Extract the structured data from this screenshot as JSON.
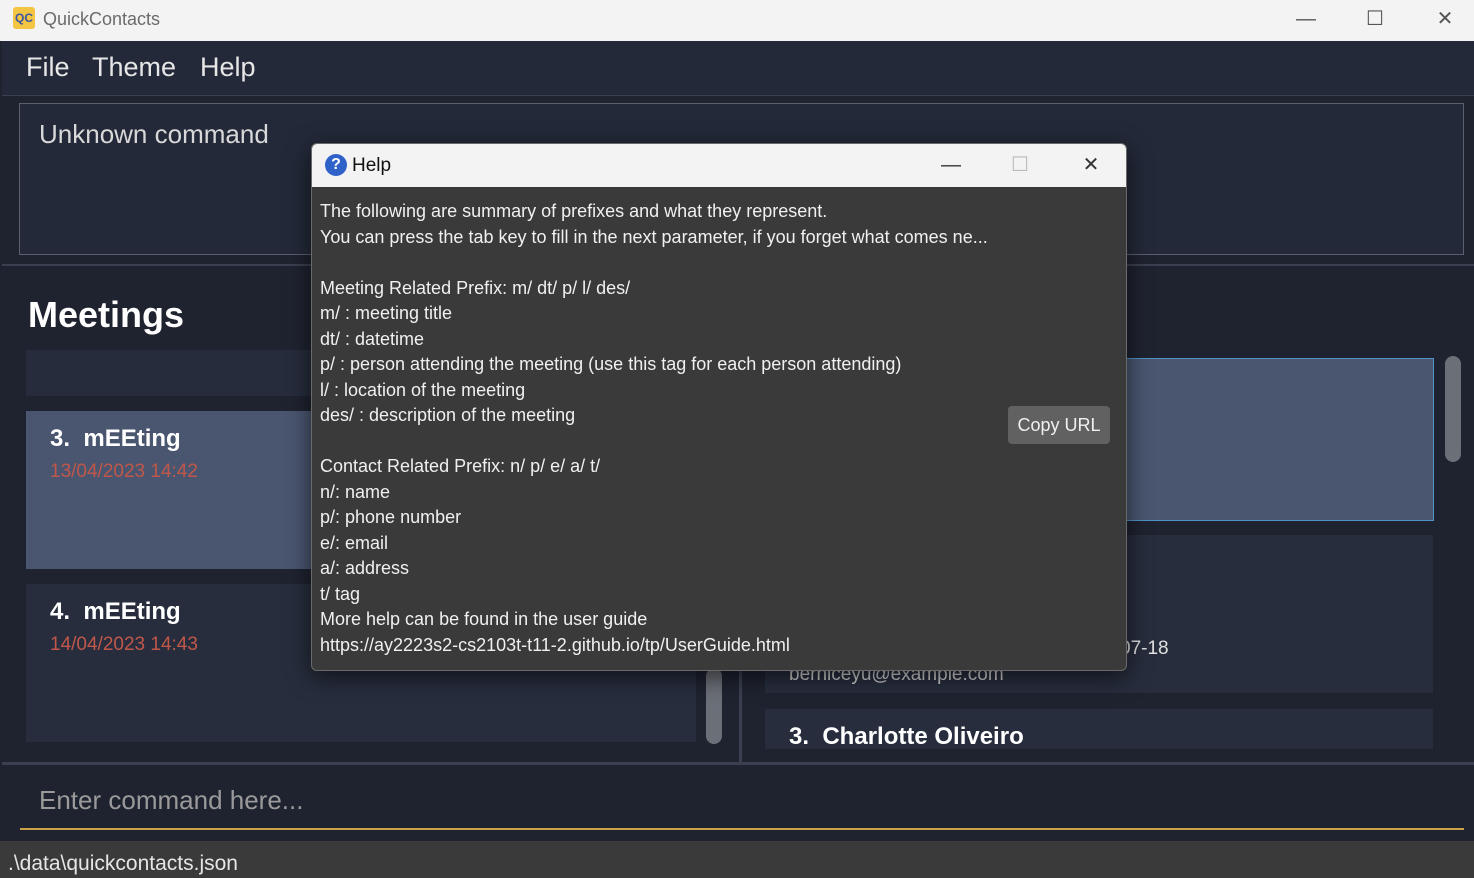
{
  "app": {
    "title": "QuickContacts",
    "icon_label": "QC",
    "window_controls": {
      "minimize": "—",
      "maximize": "☐",
      "close": "✕"
    }
  },
  "menu": [
    "File",
    "Theme",
    "Help"
  ],
  "result_display": "Unknown command",
  "meetings": {
    "title": "Meetings",
    "items": [
      {
        "index": "3.",
        "title": "mEEting",
        "datetime": "13/04/2023 14:42",
        "selected": true
      },
      {
        "index": "4.",
        "title": "mEEting",
        "datetime": "14/04/2023 14:43",
        "selected": false
      }
    ]
  },
  "contacts": {
    "partial_address": "07-18",
    "partial_email": "berniceyu@example.com",
    "third_contact": "3.  Charlotte Oliveiro"
  },
  "command": {
    "placeholder": "Enter command here..."
  },
  "status": {
    "file_path": ".\\data\\quickcontacts.json"
  },
  "help_dialog": {
    "title": "Help",
    "icon": "question-icon",
    "body": "The following are summary of prefixes and what they represent.\nYou can press the tab key to fill in the next parameter, if you forget what comes ne...\n\nMeeting Related Prefix: m/ dt/ p/ l/ des/\nm/ : meeting title\ndt/ : datetime\np/ : person attending the meeting (use this tag for each person attending)\nl/ : location of the meeting\ndes/ : description of the meeting\n\nContact Related Prefix: n/ p/ e/ a/ t/\nn/: name\np/: phone number\ne/: email\na/: address\nt/ tag\nMore help can be found in the user guide\nhttps://ay2223s2-cs2103t-t11-2.github.io/tp/UserGuide.html",
    "copy_button": "Copy URL",
    "controls": {
      "minimize": "—",
      "maximize": "☐",
      "close": "✕"
    }
  },
  "colors": {
    "background": "#1f2330",
    "selected_card": "#4a5670",
    "date_text": "#c0574a",
    "command_underline": "#c9a24a",
    "contact_selected_border": "#4f93c8"
  }
}
